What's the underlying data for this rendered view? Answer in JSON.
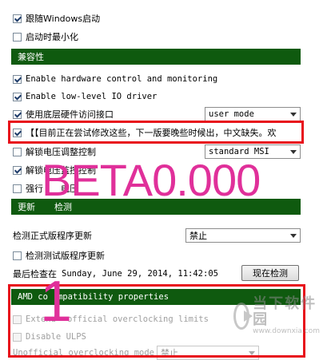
{
  "general": {
    "startup_windows": "跟随Windows启动",
    "startup_minimized": "启动时最小化"
  },
  "compatibility": {
    "header": "兼容性",
    "hw_control": "Enable hardware control and monitoring",
    "low_level_io": "Enable low-level IO driver",
    "low_level_hw_access": "使用底层硬件访问接口",
    "low_level_hw_access_mode": "user mode",
    "highlight_note": "【【目前正在尝试修改这些，下一版要晚些时候出，中文缺失。欢",
    "unlock_voltage_control": "解锁电压调整控制",
    "unlock_voltage_control_mode": "standard MSI",
    "unlock_voltage_monitor": "解锁电压监控控制",
    "force_voltage": "强行",
    "force_voltage_tail": "电压"
  },
  "update": {
    "header_prefix": "更新",
    "header_suffix": "检测",
    "check_release_label": "检测正式版程序更新",
    "check_release_value": "禁止",
    "check_beta_label": "检测测试版程序更新",
    "last_check_label": "最后检查在",
    "last_check_value": "Sunday, June 29, 2014, 11:42:05",
    "check_now_button": "现在检测"
  },
  "amd": {
    "header_a": "AMD co",
    "header_b": "mpatibility properties",
    "extend_a": "Extend",
    "extend_b": "official overclocking limits",
    "disable_ulps": "Disable ULPS",
    "unofficial_label": "Unofficial overclocking mode",
    "unofficial_value": "禁止"
  },
  "overlays": {
    "beta_text": "BETA0.000",
    "step_number": "1"
  },
  "watermark": {
    "cn": "当下软件园",
    "en": "www.downxia.com"
  },
  "colors": {
    "header_green": "#0f5a0f",
    "highlight_red": "#e8101b",
    "overlay_magenta": "#e0309a"
  }
}
